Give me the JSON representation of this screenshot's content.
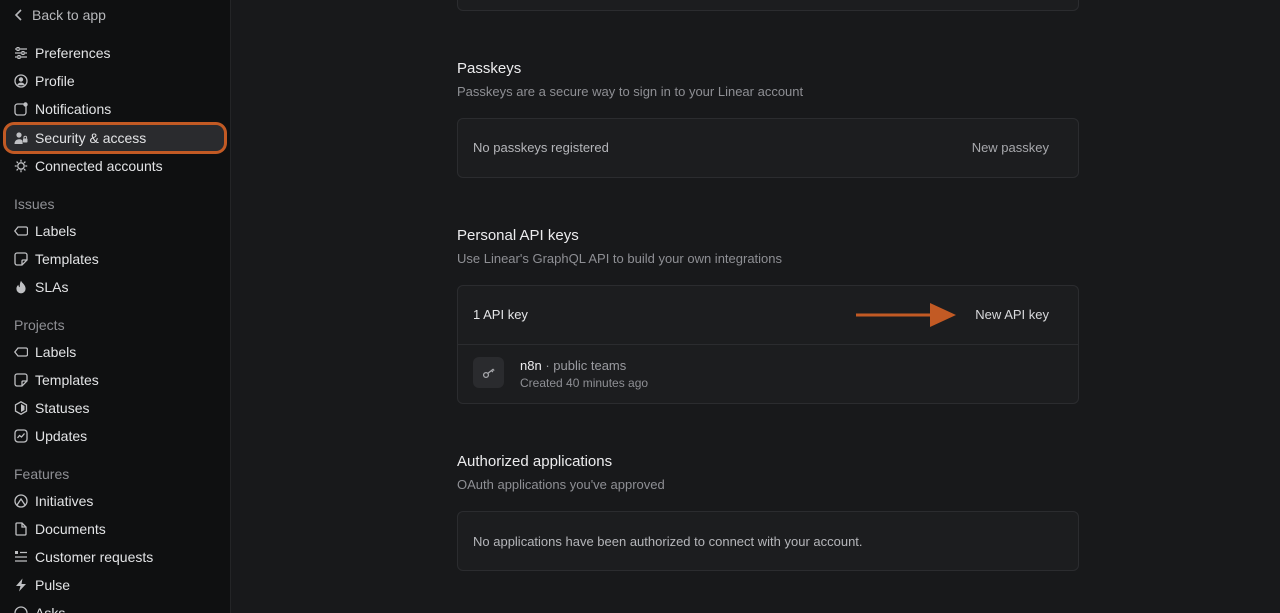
{
  "sidebar": {
    "back_label": "Back to app",
    "account_items": [
      {
        "label": "Preferences",
        "icon": "sliders-icon"
      },
      {
        "label": "Profile",
        "icon": "user-circle-icon"
      },
      {
        "label": "Notifications",
        "icon": "notification-icon"
      },
      {
        "label": "Security & access",
        "icon": "user-lock-icon",
        "active": true
      },
      {
        "label": "Connected accounts",
        "icon": "plug-gear-icon"
      }
    ],
    "issues_label": "Issues",
    "issues_items": [
      {
        "label": "Labels",
        "icon": "tag-icon"
      },
      {
        "label": "Templates",
        "icon": "template-icon"
      },
      {
        "label": "SLAs",
        "icon": "flame-icon"
      }
    ],
    "projects_label": "Projects",
    "projects_items": [
      {
        "label": "Labels",
        "icon": "tag-icon"
      },
      {
        "label": "Templates",
        "icon": "template-icon"
      },
      {
        "label": "Statuses",
        "icon": "hexagon-icon"
      },
      {
        "label": "Updates",
        "icon": "pulse-chart-icon"
      }
    ],
    "features_label": "Features",
    "features_items": [
      {
        "label": "Initiatives",
        "icon": "mountain-icon"
      },
      {
        "label": "Documents",
        "icon": "document-icon"
      },
      {
        "label": "Customer requests",
        "icon": "list-icon"
      },
      {
        "label": "Pulse",
        "icon": "lightning-icon"
      },
      {
        "label": "Asks",
        "icon": "ask-icon"
      }
    ]
  },
  "passkeys": {
    "title": "Passkeys",
    "subtitle": "Passkeys are a secure way to sign in to your Linear account",
    "empty_text": "No passkeys registered",
    "new_button": "New passkey"
  },
  "api_keys": {
    "title": "Personal API keys",
    "subtitle": "Use Linear's GraphQL API to build your own integrations",
    "count_text": "1 API key",
    "new_button": "New API key",
    "keys": [
      {
        "name": "n8n",
        "scope": "· public teams",
        "created": "Created 40 minutes ago"
      }
    ]
  },
  "authorized_apps": {
    "title": "Authorized applications",
    "subtitle": "OAuth applications you've approved",
    "empty_text": "No applications have been authorized to connect with your account."
  },
  "annotation": {
    "highlight_color": "#c25a24"
  }
}
